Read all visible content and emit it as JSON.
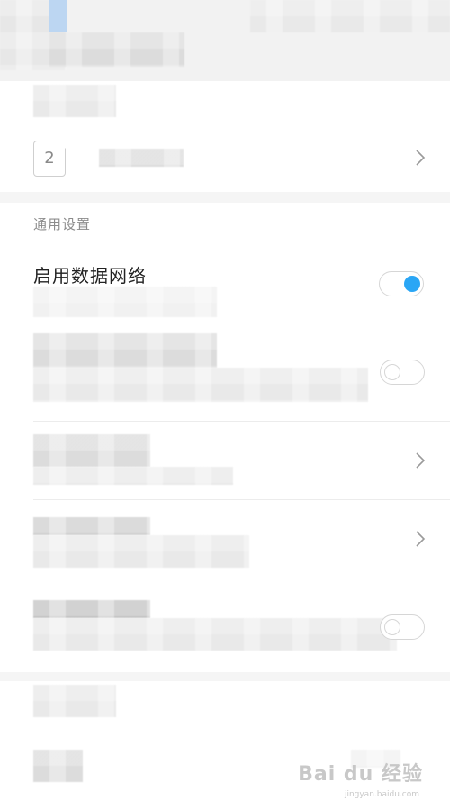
{
  "sim_card": {
    "slot_number": "2"
  },
  "general_settings": {
    "section_title": "通用设置",
    "enable_data_network": {
      "label": "启用数据网络",
      "toggle_on": true
    },
    "redacted_toggle_1": {
      "toggle_on": false
    },
    "redacted_toggle_2": {
      "toggle_on": false
    }
  },
  "colors": {
    "accent": "#2aa6f5",
    "header_bg": "#f2f2f2",
    "section_title": "#8c8c8c",
    "primary_text": "#222222"
  },
  "watermark": {
    "logo_text": "Bai du 经验",
    "url": "jingyan.baidu.com"
  },
  "icons": {
    "chevron": "chevron-right-icon",
    "sim": "sim-card-icon"
  }
}
